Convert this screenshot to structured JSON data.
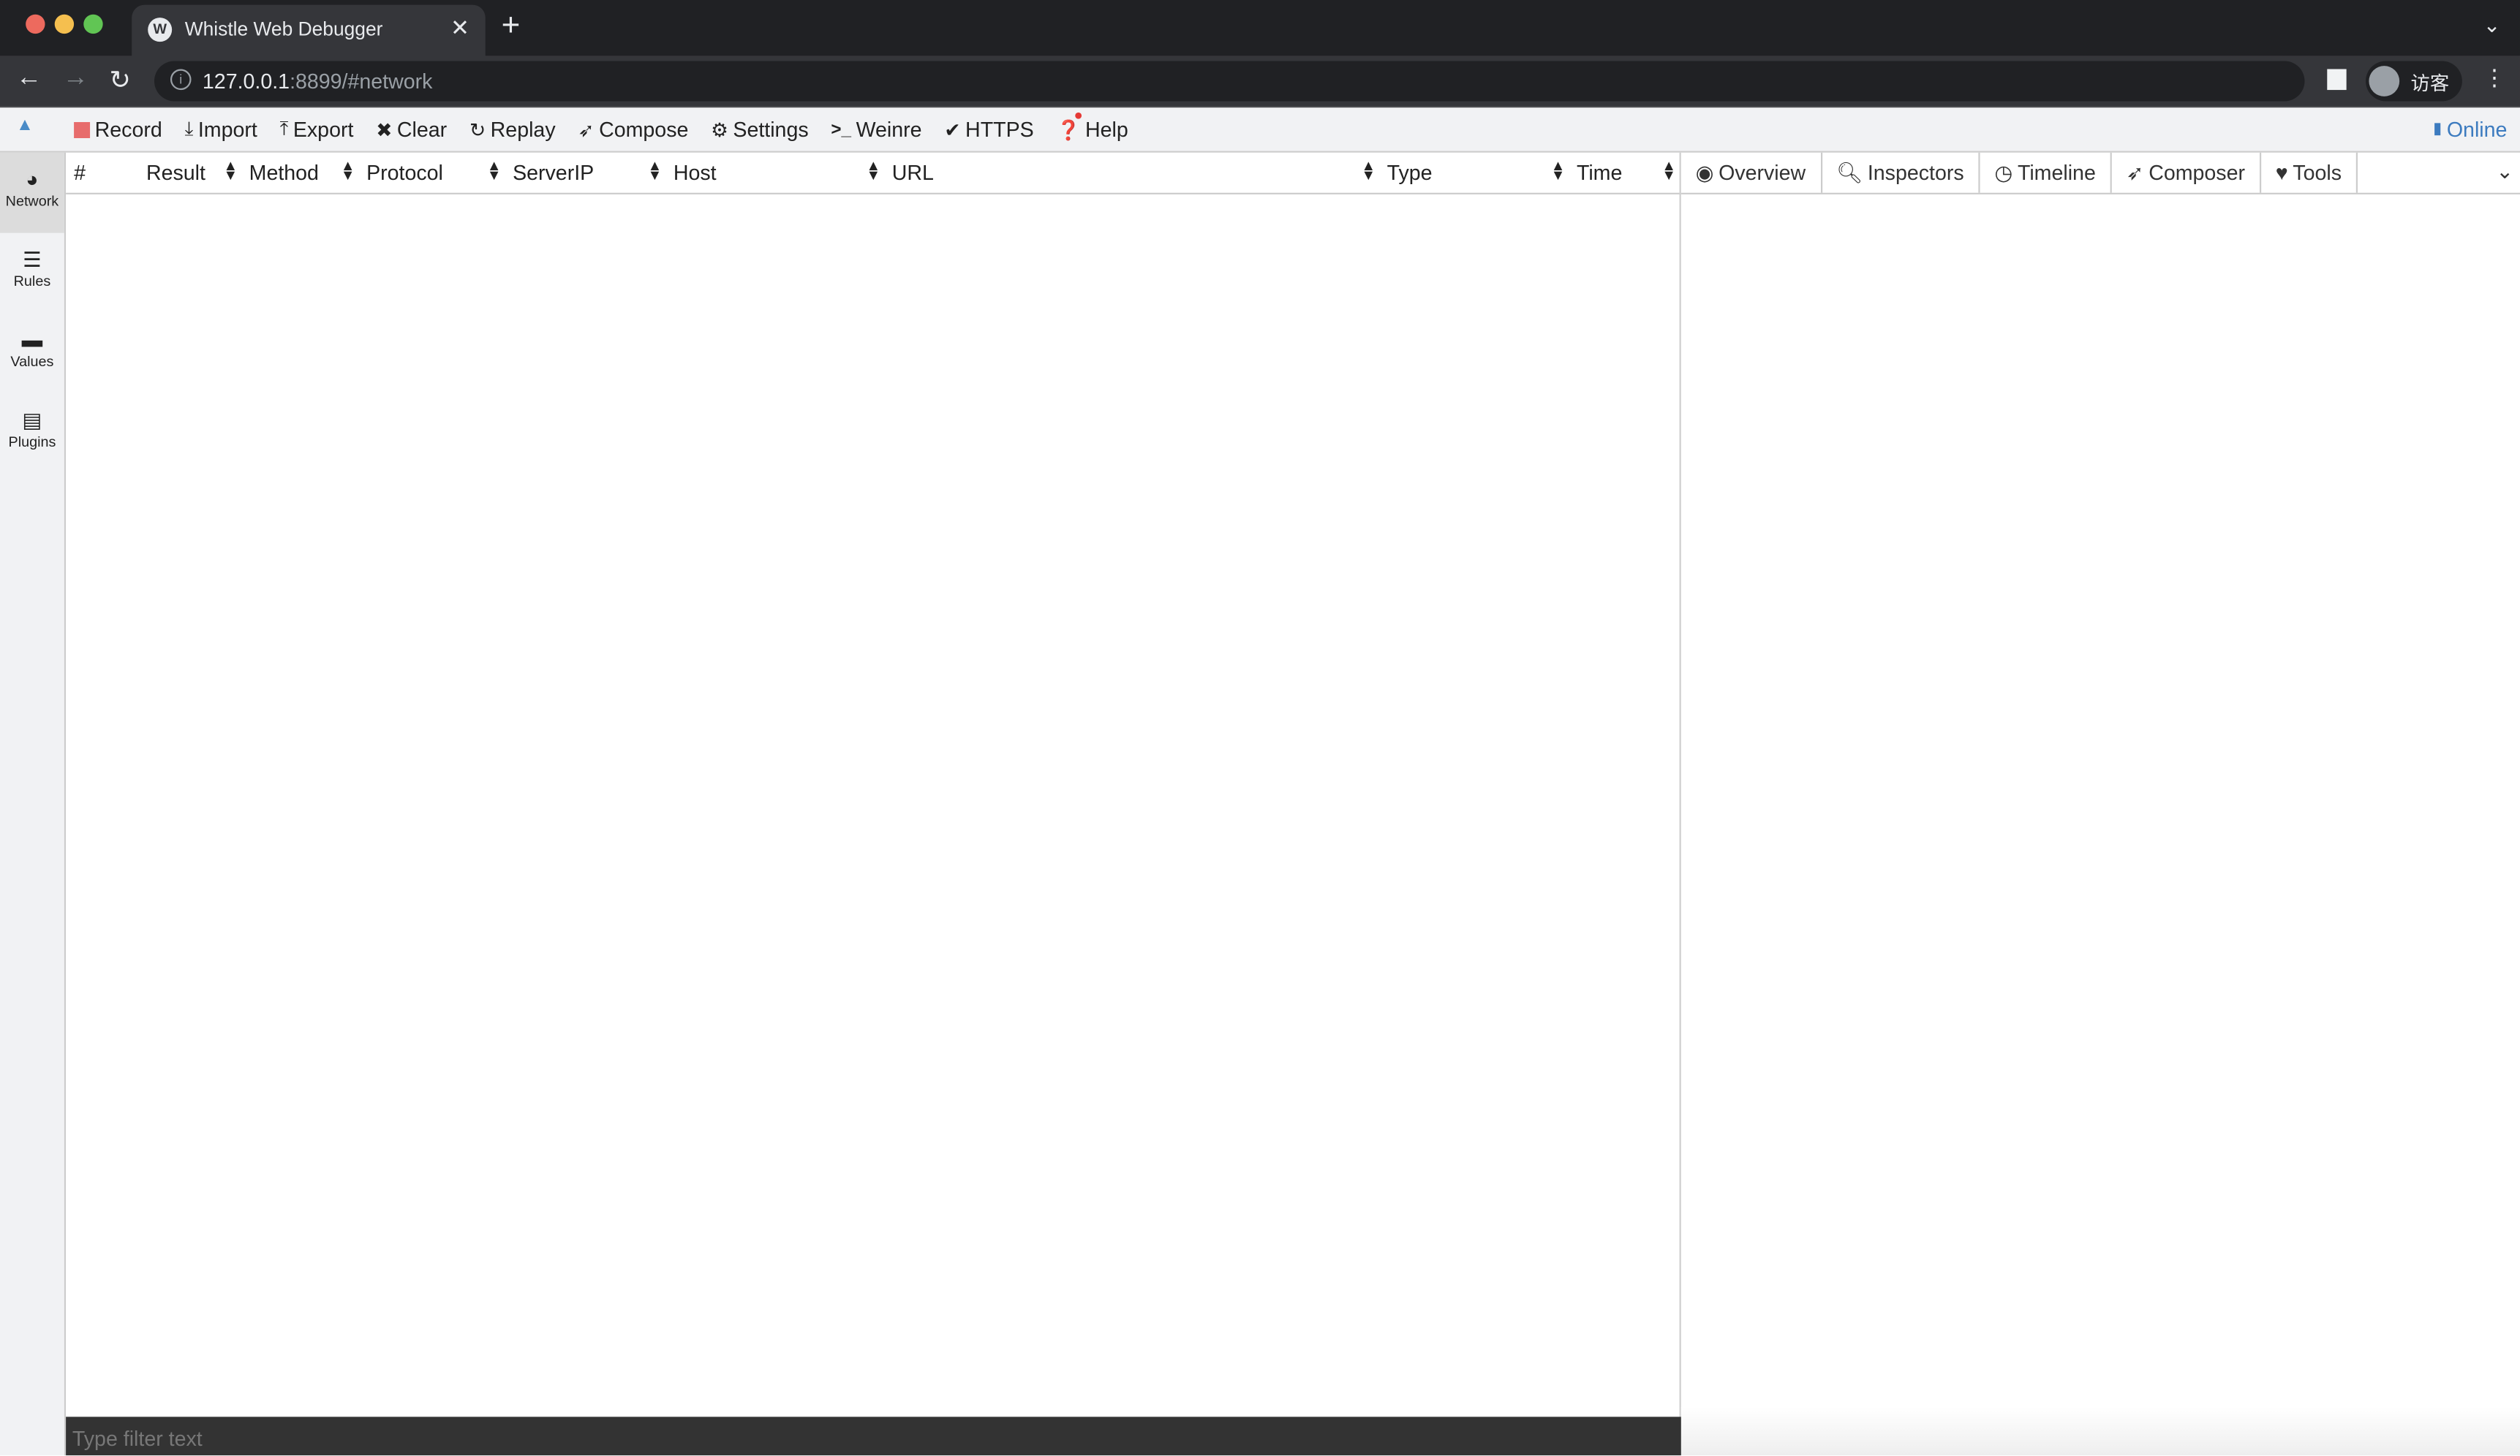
{
  "browser": {
    "tab_title": "Whistle Web Debugger",
    "favicon_letter": "W",
    "tab_close": "✕",
    "new_tab": "+",
    "tab_list": "⌄",
    "url_host": "127.0.0.1",
    "url_rest": ":8899/#network",
    "profile_name": "访客",
    "nav": {
      "back": "←",
      "forward": "→",
      "reload": "↻",
      "menu": "⋮"
    }
  },
  "toolbar": {
    "collapse_icon": "▲",
    "items": [
      {
        "id": "record",
        "label": "Record",
        "icon": ""
      },
      {
        "id": "import",
        "label": "Import",
        "icon": "⤓"
      },
      {
        "id": "export",
        "label": "Export",
        "icon": "⤒"
      },
      {
        "id": "clear",
        "label": "Clear",
        "icon": "✖"
      },
      {
        "id": "replay",
        "label": "Replay",
        "icon": "↻"
      },
      {
        "id": "compose",
        "label": "Compose",
        "icon": "➶"
      },
      {
        "id": "settings",
        "label": "Settings",
        "icon": "⚙"
      },
      {
        "id": "weinre",
        "label": "Weinre",
        "icon": ">_"
      },
      {
        "id": "https",
        "label": "HTTPS",
        "icon": "✔"
      },
      {
        "id": "help",
        "label": "Help",
        "icon": "❓"
      }
    ],
    "online_label": "Online",
    "online_icon": "▮",
    "help_badge_color": "#e53935",
    "record_color": "#e76c6c",
    "accent_color": "#3c7bbf"
  },
  "sidebar": {
    "items": [
      {
        "label": "Network",
        "icon": "◕",
        "active": true
      },
      {
        "label": "Rules",
        "icon": "☰",
        "active": false
      },
      {
        "label": "Values",
        "icon": "▬",
        "active": false
      },
      {
        "label": "Plugins",
        "icon": "▤",
        "active": false
      }
    ]
  },
  "table": {
    "columns": [
      "#",
      "Result",
      "Method",
      "Protocol",
      "ServerIP",
      "Host",
      "URL",
      "Type",
      "Time"
    ],
    "sort_icon": "⬍",
    "rows": []
  },
  "detail": {
    "tabs": [
      {
        "label": "Overview",
        "icon": "◉"
      },
      {
        "label": "Inspectors",
        "icon": "🔍︎"
      },
      {
        "label": "Timeline",
        "icon": "◷"
      },
      {
        "label": "Composer",
        "icon": "➶"
      },
      {
        "label": "Tools",
        "icon": "♥"
      }
    ],
    "more_icon": "⌄"
  },
  "filter": {
    "placeholder": "Type filter text",
    "value": ""
  }
}
